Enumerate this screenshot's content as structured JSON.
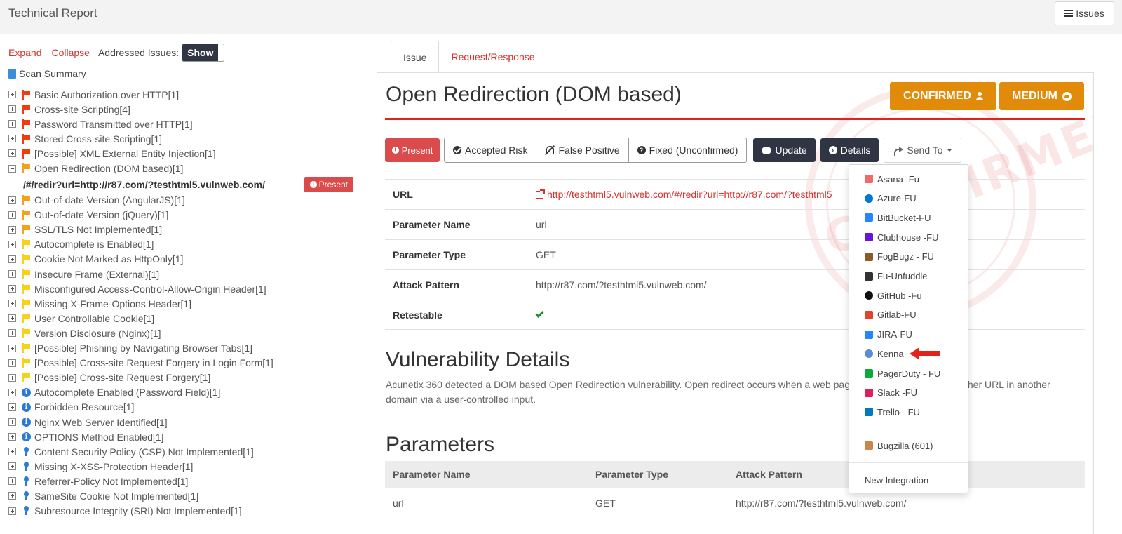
{
  "header": {
    "title": "Technical Report",
    "issues_label": "Issues"
  },
  "left": {
    "expand_label": "Expand",
    "collapse_label": "Collapse",
    "addressed_label": "Addressed Issues:",
    "show_label": "Show",
    "scan_summary_label": "Scan Summary",
    "open_child": {
      "path": "/#/redir?url=http://r87.com/?testhtml5.vulnweb.com/",
      "status": "Present"
    },
    "issues": [
      {
        "label": "Basic Authorization over HTTP[1]",
        "severity": "red",
        "icon": "flag-icon"
      },
      {
        "label": "Cross-site Scripting[4]",
        "severity": "red",
        "icon": "flag-icon"
      },
      {
        "label": "Password Transmitted over HTTP[1]",
        "severity": "red",
        "icon": "flag-icon"
      },
      {
        "label": "Stored Cross-site Scripting[1]",
        "severity": "red",
        "icon": "flag-icon"
      },
      {
        "label": "[Possible] XML External Entity Injection[1]",
        "severity": "red",
        "icon": "flag-icon"
      },
      {
        "label": "Open Redirection (DOM based)[1]",
        "severity": "orange",
        "icon": "flag-icon",
        "expanded": true
      },
      {
        "label": "Out-of-date Version (AngularJS)[1]",
        "severity": "orange",
        "icon": "flag-icon"
      },
      {
        "label": "Out-of-date Version (jQuery)[1]",
        "severity": "orange",
        "icon": "flag-icon"
      },
      {
        "label": "SSL/TLS Not Implemented[1]",
        "severity": "orange",
        "icon": "flag-icon"
      },
      {
        "label": "Autocomplete is Enabled[1]",
        "severity": "yellow",
        "icon": "flag-icon"
      },
      {
        "label": "Cookie Not Marked as HttpOnly[1]",
        "severity": "yellow",
        "icon": "flag-icon"
      },
      {
        "label": "Insecure Frame (External)[1]",
        "severity": "yellow",
        "icon": "flag-icon"
      },
      {
        "label": "Misconfigured Access-Control-Allow-Origin Header[1]",
        "severity": "yellow",
        "icon": "flag-icon"
      },
      {
        "label": "Missing X-Frame-Options Header[1]",
        "severity": "yellow",
        "icon": "flag-icon"
      },
      {
        "label": "User Controllable Cookie[1]",
        "severity": "yellow",
        "icon": "flag-icon"
      },
      {
        "label": "Version Disclosure (Nginx)[1]",
        "severity": "yellow",
        "icon": "flag-icon"
      },
      {
        "label": "[Possible] Phishing by Navigating Browser Tabs[1]",
        "severity": "yellow",
        "icon": "flag-icon"
      },
      {
        "label": "[Possible] Cross-site Request Forgery in Login Form[1]",
        "severity": "yellow",
        "icon": "flag-icon"
      },
      {
        "label": "[Possible] Cross-site Request Forgery[1]",
        "severity": "yellow",
        "icon": "flag-icon"
      },
      {
        "label": "Autocomplete Enabled (Password Field)[1]",
        "severity": "info",
        "icon": "info-icon"
      },
      {
        "label": "Forbidden Resource[1]",
        "severity": "info",
        "icon": "info-icon"
      },
      {
        "label": "Nginx Web Server Identified[1]",
        "severity": "info",
        "icon": "info-icon"
      },
      {
        "label": "OPTIONS Method Enabled[1]",
        "severity": "info",
        "icon": "info-icon"
      },
      {
        "label": "Content Security Policy (CSP) Not Implemented[1]",
        "severity": "best-practice",
        "icon": "lightbulb-icon"
      },
      {
        "label": "Missing X-XSS-Protection Header[1]",
        "severity": "best-practice",
        "icon": "lightbulb-icon"
      },
      {
        "label": "Referrer-Policy Not Implemented[1]",
        "severity": "best-practice",
        "icon": "lightbulb-icon"
      },
      {
        "label": "SameSite Cookie Not Implemented[1]",
        "severity": "best-practice",
        "icon": "lightbulb-icon"
      },
      {
        "label": "Subresource Integrity (SRI) Not Implemented[1]",
        "severity": "best-practice",
        "icon": "lightbulb-icon"
      }
    ]
  },
  "tabs": [
    {
      "label": "Issue",
      "active": true
    },
    {
      "label": "Request/Response",
      "active": false
    }
  ],
  "issue": {
    "title": "Open Redirection (DOM based)",
    "confirmed_label": "CONFIRMED",
    "severity_label": "MEDIUM",
    "stamp_text": "CONFIRMED",
    "actions": {
      "present": "Present",
      "accepted_risk": "Accepted Risk",
      "false_positive": "False Positive",
      "fixed": "Fixed (Unconfirmed)",
      "update": "Update",
      "details": "Details",
      "send_to": "Send To"
    },
    "info": [
      {
        "key": "URL",
        "value": "http://testhtml5.vulnweb.com/#/redir?url=http://r87.com/?testhtml5",
        "is_link": true
      },
      {
        "key": "Parameter Name",
        "value": "url"
      },
      {
        "key": "Parameter Type",
        "value": "GET"
      },
      {
        "key": "Attack Pattern",
        "value": "http://r87.com/?testhtml5.vulnweb.com/"
      },
      {
        "key": "Retestable",
        "value": "",
        "icon": "check-icon"
      }
    ],
    "vuln_heading": "Vulnerability Details",
    "vuln_desc_line1": "Acunetix 360 detected a DOM based Open Redirection vulnerability. Open redirect occurs when a web pag",
    "vuln_desc_line1_tail": "ther URL in another",
    "vuln_desc_line2": "domain via a user-controlled input.",
    "params_heading": "Parameters",
    "params_table": {
      "headers": [
        "Parameter Name",
        "Parameter Type",
        "Attack Pattern"
      ],
      "rows": [
        [
          "url",
          "GET",
          "http://r87.com/?testhtml5.vulnweb.com/"
        ]
      ]
    }
  },
  "send_to_menu": {
    "integrations": [
      {
        "label": "Asana -Fu",
        "icon": "asana-icon",
        "color": "#f06a6a"
      },
      {
        "label": "Azure-FU",
        "icon": "azure-icon",
        "color": "#0078d4"
      },
      {
        "label": "BitBucket-FU",
        "icon": "bitbucket-icon",
        "color": "#2684ff"
      },
      {
        "label": "Clubhouse -FU",
        "icon": "clubhouse-icon",
        "color": "#6515dd"
      },
      {
        "label": "FogBugz - FU",
        "icon": "fogbugz-icon",
        "color": "#8a5a2b"
      },
      {
        "label": "Fu-Unfuddle",
        "icon": "unfuddle-icon",
        "color": "#333333"
      },
      {
        "label": "GitHub -Fu",
        "icon": "github-icon",
        "color": "#111111"
      },
      {
        "label": "Gitlab-FU",
        "icon": "gitlab-icon",
        "color": "#e24329"
      },
      {
        "label": "JIRA-FU",
        "icon": "jira-icon",
        "color": "#2684ff"
      },
      {
        "label": "Kenna",
        "icon": "kenna-icon",
        "color": "#5b8bd8"
      },
      {
        "label": "PagerDuty - FU",
        "icon": "pagerduty-icon",
        "color": "#06ac38"
      },
      {
        "label": "Slack -FU",
        "icon": "slack-icon",
        "color": "#e01e5a"
      },
      {
        "label": "Trello - FU",
        "icon": "trello-icon",
        "color": "#0079bf"
      }
    ],
    "bugzilla_label": "Bugzilla (601)",
    "new_integration_label": "New Integration"
  }
}
